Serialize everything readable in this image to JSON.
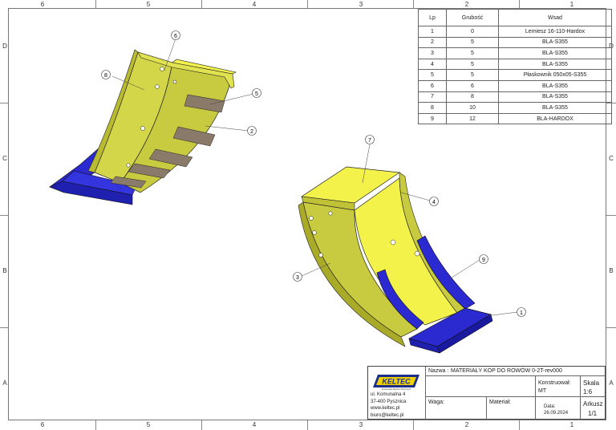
{
  "zones": {
    "columns": [
      "6",
      "5",
      "4",
      "3",
      "2",
      "1"
    ],
    "rows": [
      "D",
      "C",
      "B",
      "A"
    ]
  },
  "bom": {
    "headers": {
      "lp": "Lp",
      "thickness": "Grubość",
      "insert": "Wsad"
    },
    "rows": [
      {
        "lp": "1",
        "thickness": "0",
        "insert": "Lemiesz 16-110-Hardox"
      },
      {
        "lp": "2",
        "thickness": "5",
        "insert": "BLA-S355"
      },
      {
        "lp": "3",
        "thickness": "5",
        "insert": "BLA-S355"
      },
      {
        "lp": "4",
        "thickness": "5",
        "insert": "BLA-S355"
      },
      {
        "lp": "5",
        "thickness": "5",
        "insert": "Płaskownik 050x05-S355"
      },
      {
        "lp": "6",
        "thickness": "6",
        "insert": "BLA-S355"
      },
      {
        "lp": "7",
        "thickness": "8",
        "insert": "BLA-S355"
      },
      {
        "lp": "8",
        "thickness": "10",
        "insert": "BLA-S355"
      },
      {
        "lp": "9",
        "thickness": "12",
        "insert": "BLA-HARDOX"
      }
    ]
  },
  "balloons": [
    "1",
    "2",
    "3",
    "4",
    "5",
    "6",
    "7",
    "8",
    "9"
  ],
  "title_block": {
    "company_logo": "KELTEC",
    "company_tagline": "Konstrukcje Maszyn Rolniczych",
    "address": [
      "ul. Komunalna 4",
      "37-400 Pysznica",
      "www.keltec.pl",
      "biuro@keltec.pl"
    ],
    "name_label": "Nazwa :",
    "name_value": "MATERIAŁY KOP DO ROWÓW 0-2T-rev000",
    "designer_label": "Konstruował:",
    "designer_value": "MT",
    "scale_label": "Skala",
    "scale_value": "1:6",
    "weight_label": "Waga:",
    "material_label": "Materiał:",
    "date_label": "Data:",
    "date_value": "26.09.2024",
    "sheet_label": "Arkusz",
    "sheet_value": "1/1"
  },
  "colors": {
    "body_yellow": "#d4d64a",
    "bright_yellow": "#f2f24a",
    "blade_blue": "#2a2ad0",
    "wear_plate": "#8a7a6a",
    "logo_yellow": "#f0d000",
    "logo_blue": "#1b2f8a"
  }
}
